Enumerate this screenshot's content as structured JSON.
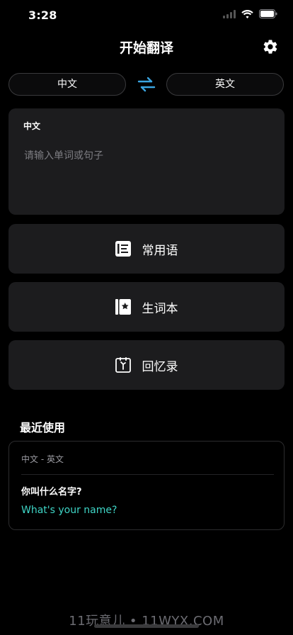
{
  "status": {
    "time": "3:28"
  },
  "header": {
    "title": "开始翻译"
  },
  "languages": {
    "source": "中文",
    "target": "英文"
  },
  "input": {
    "language_label": "中文",
    "placeholder": "请输入单词或句子",
    "value": ""
  },
  "features": [
    {
      "label": "常用语",
      "icon": "phrases-icon"
    },
    {
      "label": "生词本",
      "icon": "vocabulary-book-icon"
    },
    {
      "label": "回忆录",
      "icon": "memoir-icon"
    }
  ],
  "recent": {
    "title": "最近使用",
    "items": [
      {
        "pair": "中文 - 英文",
        "source": "你叫什么名字?",
        "target": "What's your name?"
      }
    ]
  },
  "watermark": "11玩意儿 • 11WYX.COM",
  "colors": {
    "background": "#000000",
    "card": "#1c1c1e",
    "accent": "#3fd6c7",
    "swap_icon": "#3aa4e0"
  }
}
